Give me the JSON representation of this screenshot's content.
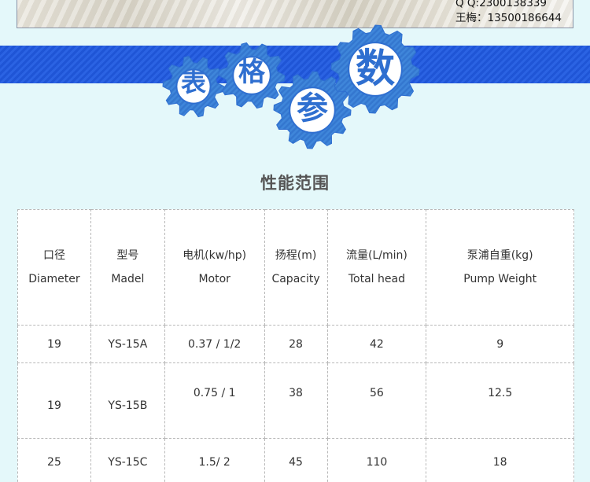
{
  "contact": {
    "qq": "Q  Q:2300138339",
    "phone": "王梅：13500186644"
  },
  "banner": {
    "chars": [
      "表",
      "格",
      "参",
      "数"
    ]
  },
  "section_title": "性能范围",
  "table": {
    "columns": [
      {
        "cn": "口径",
        "en": "Diameter"
      },
      {
        "cn": "型号",
        "en": "Madel"
      },
      {
        "cn": "电机(kw/hp)",
        "en": "Motor"
      },
      {
        "cn": "扬程(m)",
        "en": "Capacity"
      },
      {
        "cn": "流量(L/min)",
        "en": "Total head"
      },
      {
        "cn": "泵浦自重(kg)",
        "en": "Pump Weight"
      }
    ],
    "rows": [
      [
        "19",
        "YS-15A",
        "0.37 / 1/2",
        "28",
        "42",
        "9"
      ],
      [
        "19",
        "YS-15B",
        "0.75 / 1",
        "38",
        "56",
        "12.5"
      ],
      [
        "25",
        "YS-15C",
        "1.5/ 2",
        "45",
        "110",
        "18"
      ]
    ]
  },
  "colors": {
    "band": "#2459dc",
    "gear": "#3a7fd6",
    "gear_char": "#2f6fd0",
    "background": "#e4f8fa"
  }
}
